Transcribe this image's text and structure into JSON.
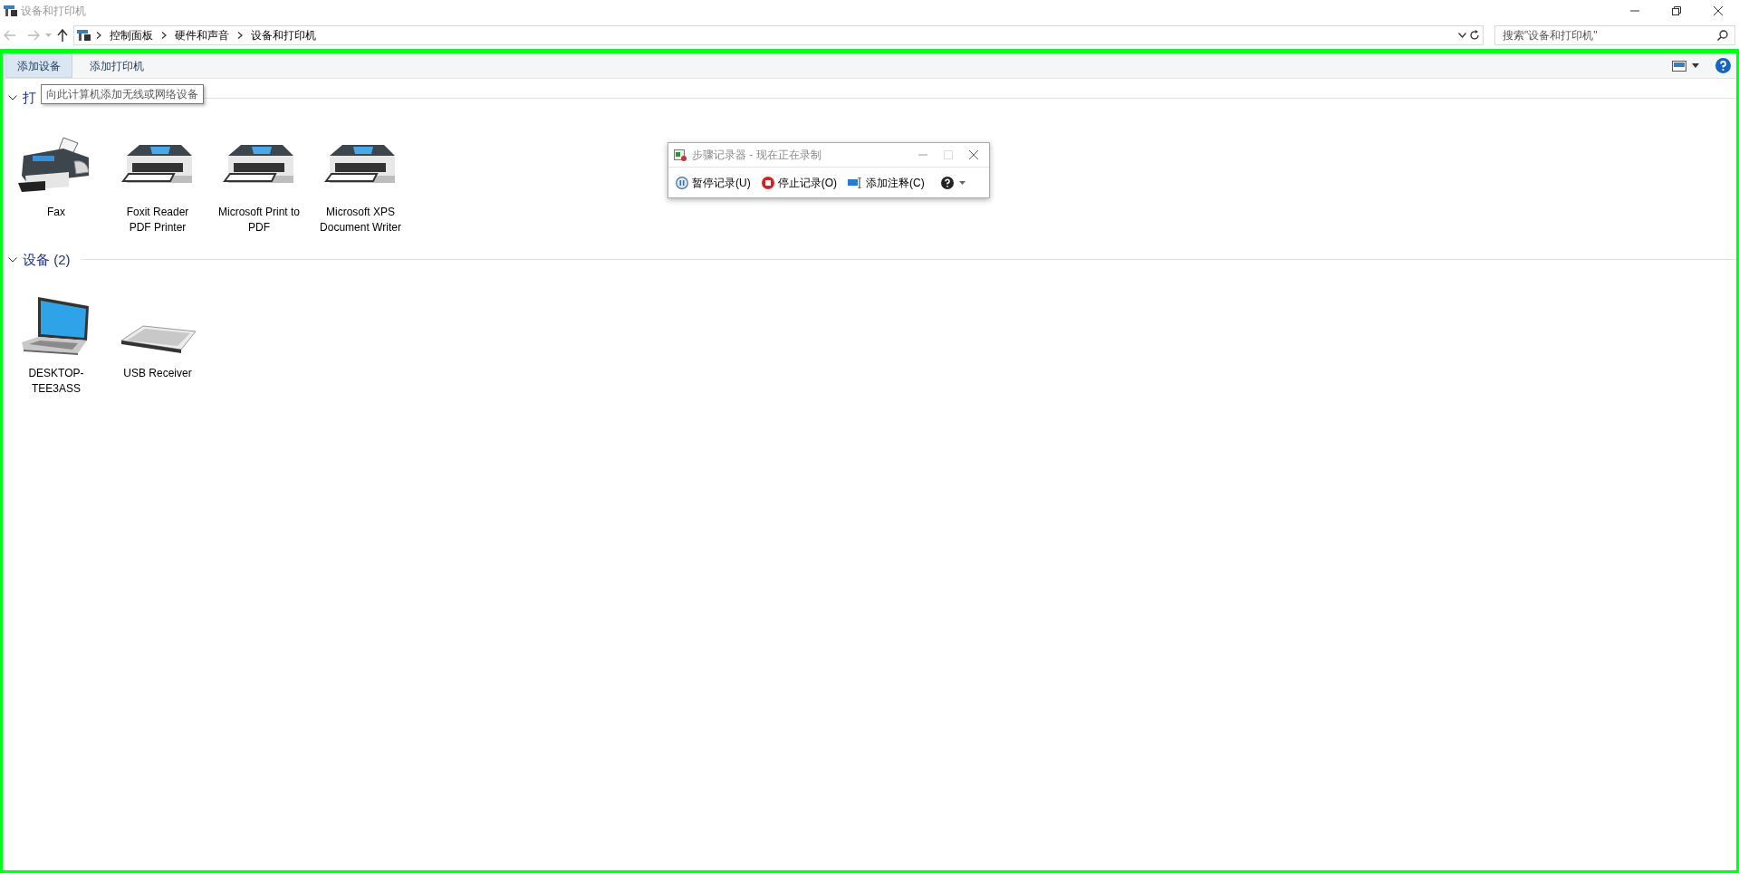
{
  "window": {
    "title": "设备和打印机"
  },
  "address_bar": {
    "breadcrumbs": [
      "控制面板",
      "硬件和声音",
      "设备和打印机"
    ]
  },
  "search": {
    "placeholder": "搜索\"设备和打印机\""
  },
  "toolbar": {
    "buttons": [
      {
        "label": "添加设备",
        "selected": true
      },
      {
        "label": "添加打印机",
        "selected": false
      }
    ]
  },
  "tooltip": {
    "text": "向此计算机添加无线或网络设备"
  },
  "groups": [
    {
      "heading": "打",
      "items": [
        {
          "name": "Fax",
          "kind": "fax"
        },
        {
          "name": "Foxit Reader PDF Printer",
          "kind": "printer"
        },
        {
          "name": "Microsoft Print to PDF",
          "kind": "printer"
        },
        {
          "name": "Microsoft XPS Document Writer",
          "kind": "printer"
        }
      ]
    },
    {
      "heading": "设备 (2)",
      "items": [
        {
          "name": "DESKTOP-TEE3ASS",
          "kind": "laptop"
        },
        {
          "name": "USB Receiver",
          "kind": "keyboard"
        }
      ]
    }
  ],
  "recorder": {
    "title": "步骤记录器 - 现在正在录制",
    "buttons": [
      {
        "label": "暂停记录(U)",
        "kind": "pause"
      },
      {
        "label": "停止记录(O)",
        "kind": "stop"
      },
      {
        "label": "添加注释(C)",
        "kind": "comment"
      }
    ]
  }
}
